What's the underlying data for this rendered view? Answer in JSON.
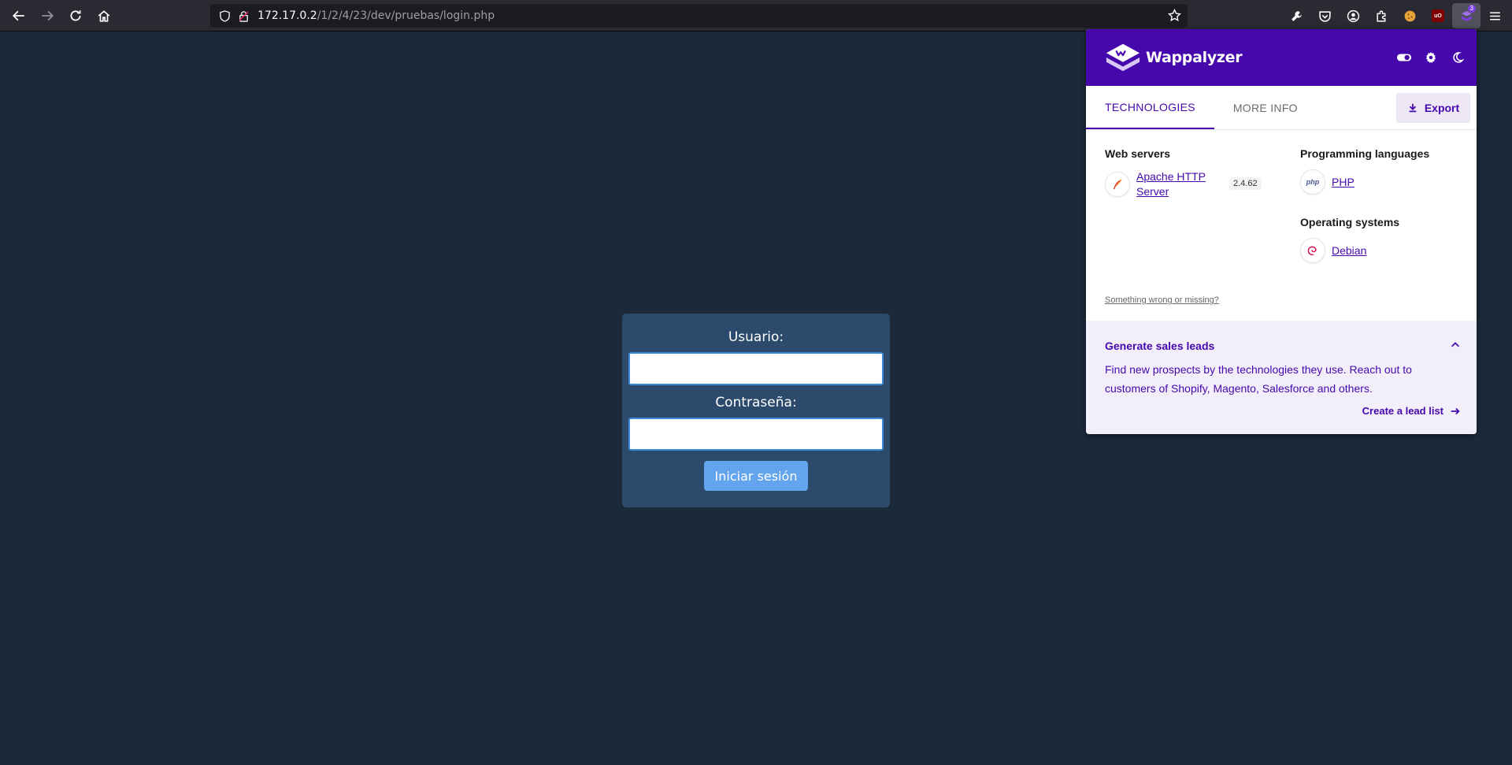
{
  "browser": {
    "url_host": "172.17.0.2",
    "url_path": "/1/2/4/23/dev/pruebas/login.php",
    "extension_badge": "3",
    "ubo_label": "uO"
  },
  "login": {
    "user_label": "Usuario:",
    "password_label": "Contraseña:",
    "submit_label": "Iniciar sesión"
  },
  "wappalyzer": {
    "title": "Wappalyzer",
    "tabs": [
      {
        "label": "TECHNOLOGIES",
        "active": true
      },
      {
        "label": "MORE INFO",
        "active": false
      }
    ],
    "export_label": "Export",
    "categories": {
      "web_servers": {
        "title": "Web servers",
        "tech_line1": "Apache HTTP",
        "tech_line2": "Server",
        "version": "2.4.62"
      },
      "programming_languages": {
        "title": "Programming languages",
        "tech": "PHP",
        "icon_text": "php"
      },
      "operating_systems": {
        "title": "Operating systems",
        "tech": "Debian"
      }
    },
    "wrong_link": "Something wrong or missing?",
    "leads": {
      "title": "Generate sales leads",
      "text": "Find new prospects by the technologies they use. Reach out to customers of Shopify, Magento, Salesforce and others.",
      "link": "Create a lead list"
    }
  },
  "colors": {
    "page_bg": "#1b2a3b",
    "login_box": "#2c4a6b",
    "login_button": "#62a4ed",
    "wappalyzer_purple": "#4608ad"
  }
}
